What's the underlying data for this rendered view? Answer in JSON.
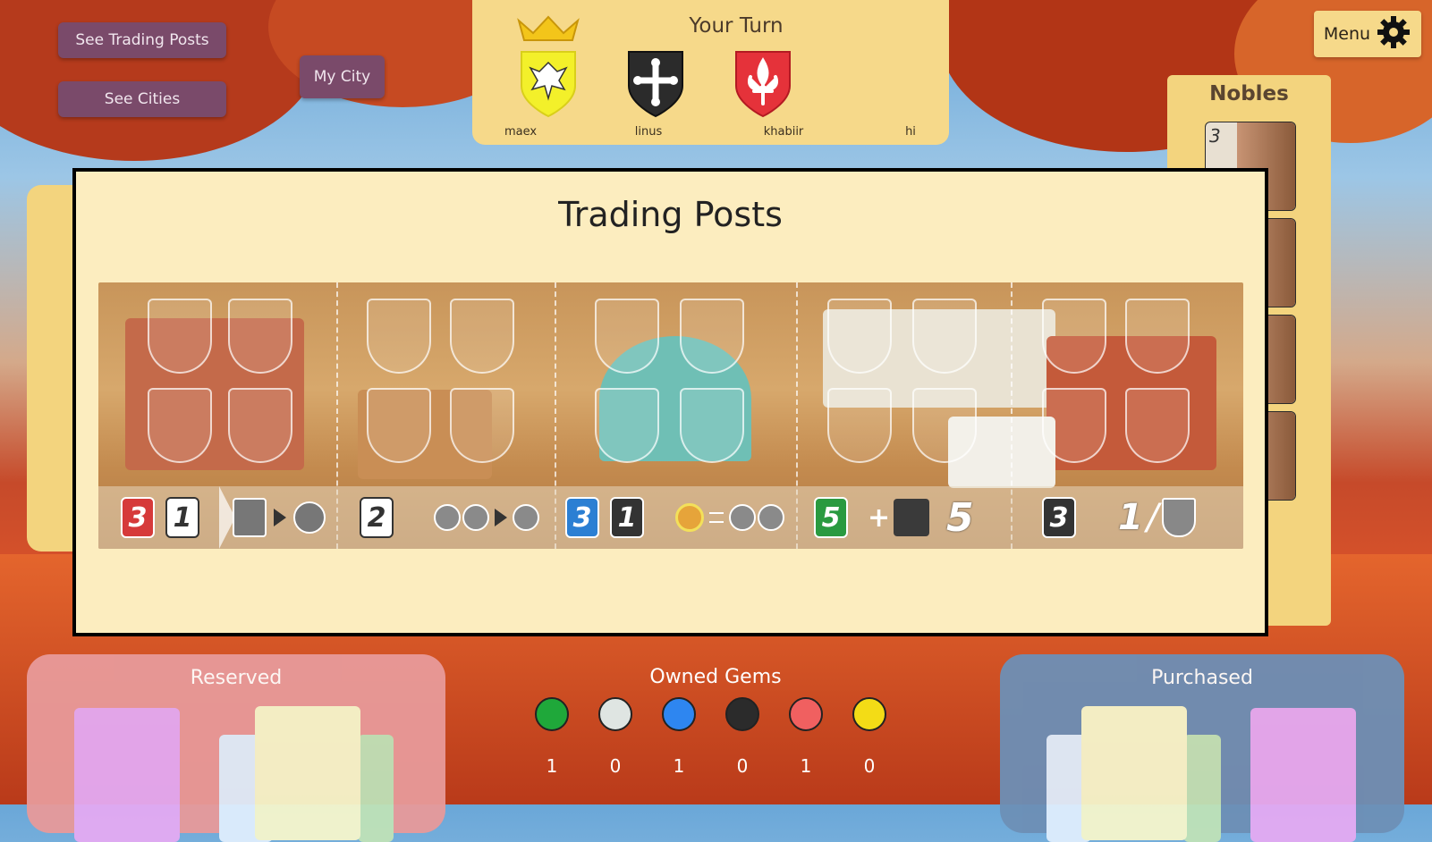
{
  "nav": {
    "see_trading_posts": "See Trading Posts",
    "see_cities": "See Cities",
    "my_city": "My City"
  },
  "turn_panel": {
    "title": "Your Turn",
    "players": [
      {
        "name": "maex",
        "color": "#f3f02a",
        "icon": "eagle-icon"
      },
      {
        "name": "linus",
        "color": "#2b2b2b",
        "icon": "cross-icon"
      },
      {
        "name": "khabiir",
        "color": "#e5323a",
        "icon": "fleur-de-lis-icon"
      },
      {
        "name": "hi",
        "color": "",
        "icon": ""
      }
    ]
  },
  "menu": {
    "label": "Menu",
    "icon": "gear-icon"
  },
  "nobles": {
    "title": "Nobles",
    "cards": [
      {
        "points": "3"
      },
      {
        "points": ""
      },
      {
        "points": ""
      },
      {
        "points": ""
      }
    ]
  },
  "modal": {
    "title": "Trading Posts",
    "token_labels": [
      "3",
      "1",
      "2",
      "3",
      "1",
      "5",
      "5",
      "3",
      "1"
    ]
  },
  "reserved": {
    "title": "Reserved"
  },
  "purchased": {
    "title": "Purchased"
  },
  "owned_gems": {
    "title": "Owned Gems",
    "gems": [
      {
        "name": "emerald",
        "color": "#1fa83a",
        "count": "1"
      },
      {
        "name": "diamond",
        "color": "#dfe5e2",
        "count": "0"
      },
      {
        "name": "sapphire",
        "color": "#2e86f0",
        "count": "1"
      },
      {
        "name": "onyx",
        "color": "#2b2b2b",
        "count": "0"
      },
      {
        "name": "ruby",
        "color": "#f06060",
        "count": "1"
      },
      {
        "name": "gold",
        "color": "#f3dc16",
        "count": "0"
      }
    ]
  }
}
